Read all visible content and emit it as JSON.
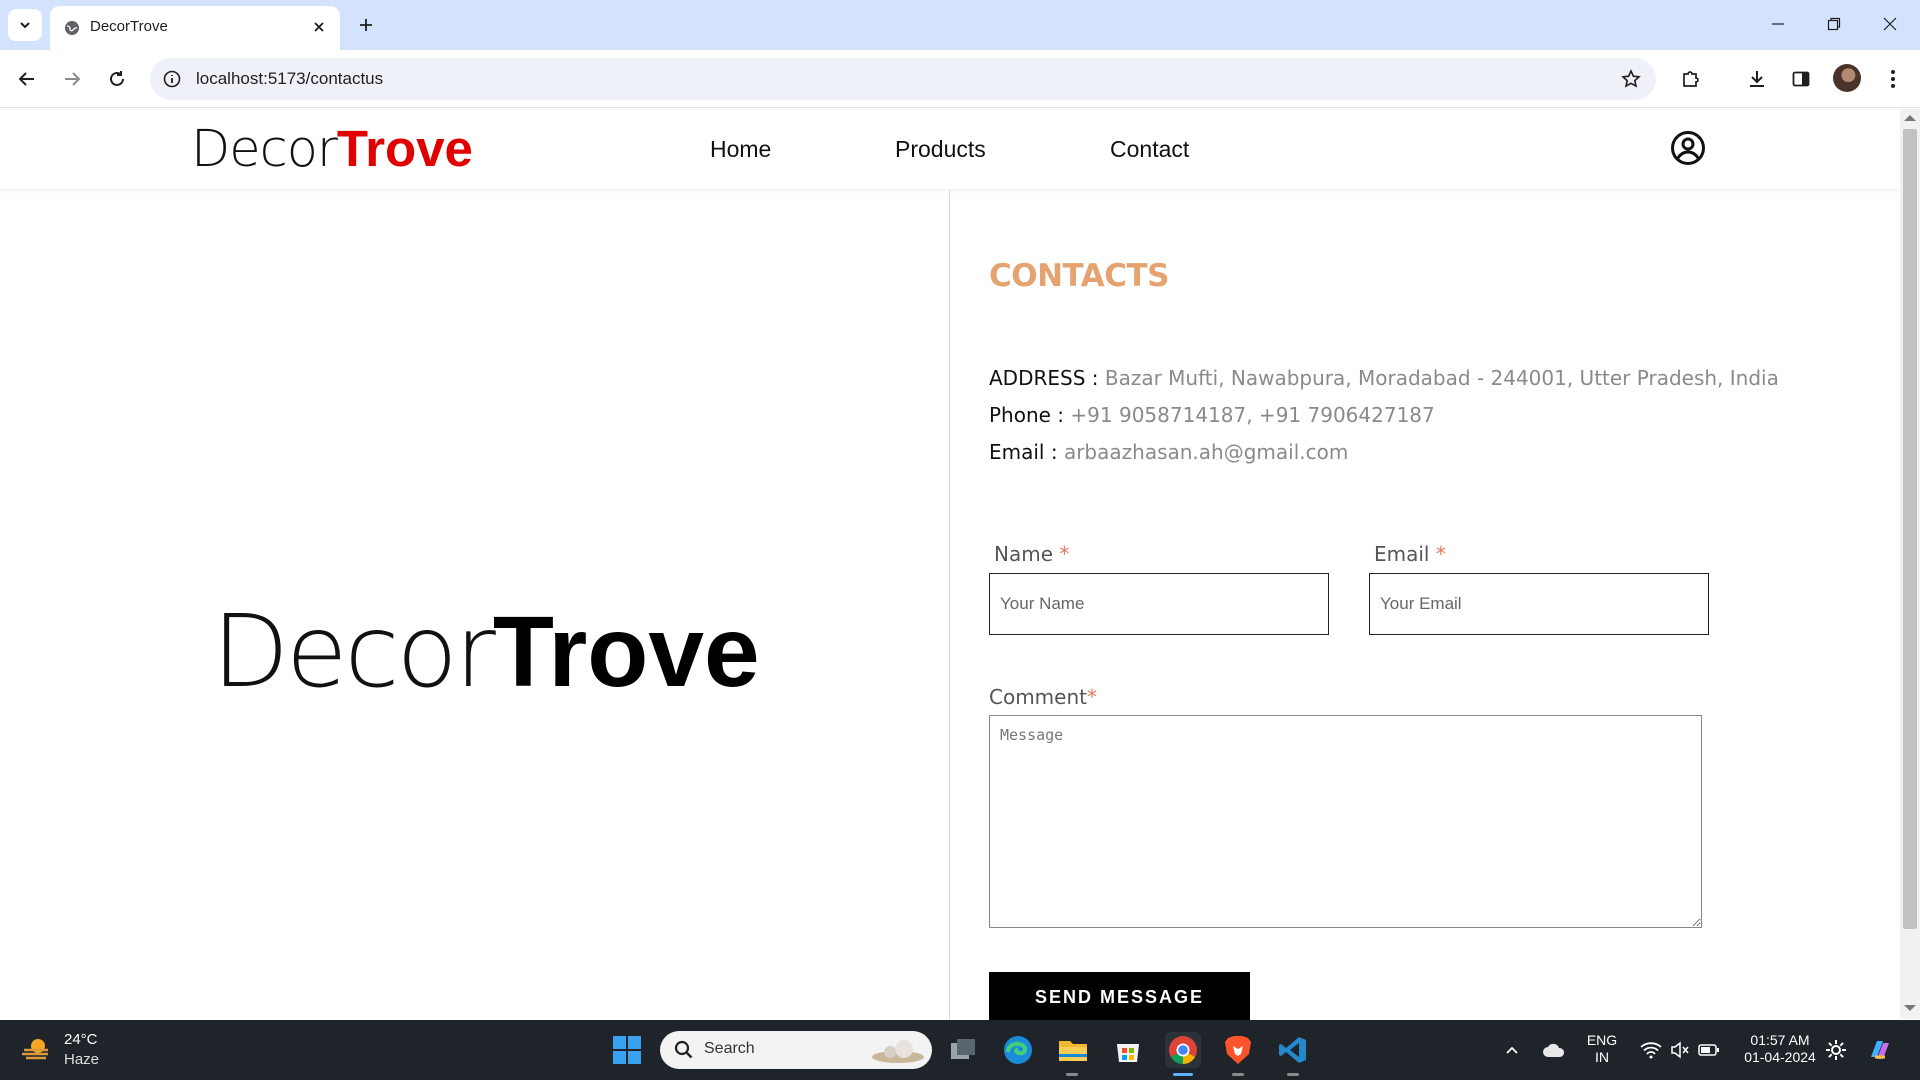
{
  "browser": {
    "tab_title": "DecorTrove",
    "url": "localhost:5173/contactus",
    "icons": [
      "tab-list-icon",
      "globe-icon",
      "close-icon",
      "plus-icon",
      "minimize-icon",
      "restore-icon",
      "window-close-icon",
      "back-icon",
      "forward-icon",
      "reload-icon",
      "info-icon",
      "star-icon",
      "extensions-icon",
      "download-icon",
      "sidepanel-icon",
      "avatar",
      "more-icon"
    ]
  },
  "site": {
    "logo_part1": "Decor",
    "logo_part2": "Trove",
    "brand_color": "#e00000",
    "nav": {
      "home": "Home",
      "products": "Products",
      "contact": "Contact"
    }
  },
  "hero": {
    "logo_part1": "Decor",
    "logo_part2": "Trove"
  },
  "contact": {
    "heading": "CONTACTS",
    "heading_color": "#e5a36f",
    "address_label": "ADDRESS : ",
    "address_value": "Bazar Mufti, Nawabpura, Moradabad - 244001, Utter Pradesh, India",
    "phone_label": "Phone : ",
    "phone_value": "+91 9058714187, +91 7906427187",
    "email_label": "Email : ",
    "email_value": "arbaazhasan.ah@gmail.com"
  },
  "form": {
    "name_label": "Name ",
    "name_required": "*",
    "name_placeholder": "Your Name",
    "email_label": "Email ",
    "email_required": "*",
    "email_placeholder": "Your Email",
    "comment_label": "Comment",
    "comment_required": "*",
    "comment_placeholder": "Message",
    "submit_label": "SEND MESSAGE"
  },
  "taskbar": {
    "temperature": "24°C",
    "weather": "Haze",
    "search_placeholder": "Search",
    "lang_line1": "ENG",
    "lang_line2": "IN",
    "time": "01:57 AM",
    "date": "01-04-2024"
  }
}
